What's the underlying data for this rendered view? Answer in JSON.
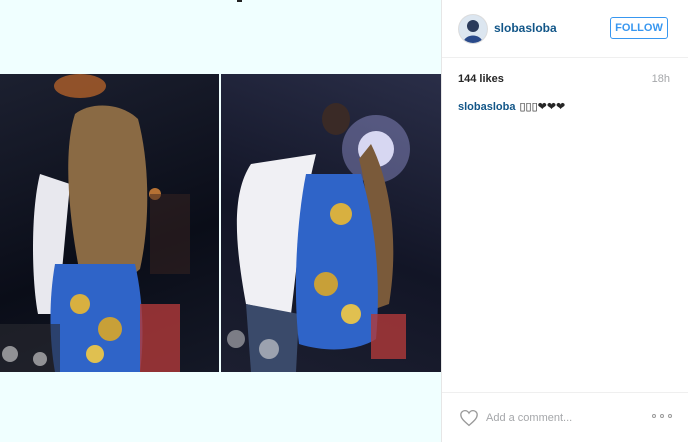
{
  "post": {
    "photo_icon": "photo-collage",
    "colors": {
      "background": "#f0ffff",
      "link": "#125688",
      "follow": "#3897f0",
      "muted": "#a5a7aa"
    }
  },
  "header": {
    "avatar_icon": "user-avatar",
    "username": "slobasloba",
    "follow_label": "FOLLOW"
  },
  "meta": {
    "likes": "144 likes",
    "time": "18h"
  },
  "caption": {
    "username": "slobasloba",
    "text": "▯▯▯❤❤❤"
  },
  "footer": {
    "like_icon": "heart-icon",
    "comment_placeholder": "Add a comment...",
    "more_icon": "more-options-icon"
  }
}
